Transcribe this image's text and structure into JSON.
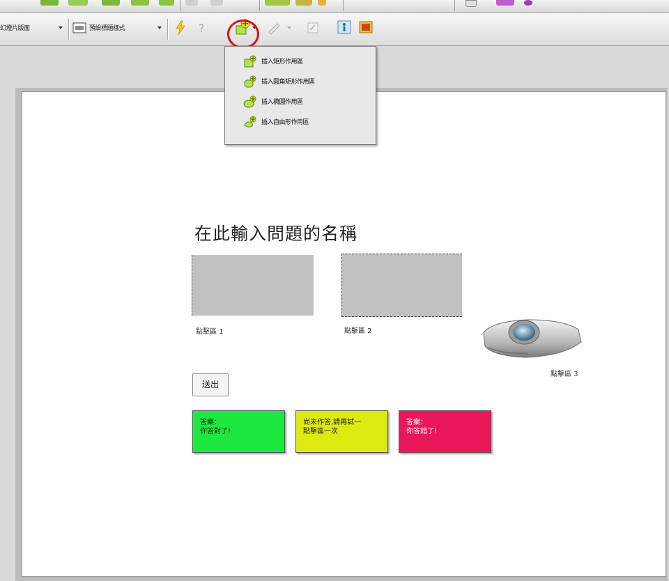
{
  "toolbar": {
    "slide_layout_label": "幻燈片版面",
    "text_style_label": "預設標題樣式",
    "insert_hotspot_tooltip_icon": "add-hotspot-icon"
  },
  "dropdown": {
    "items": [
      {
        "label": "插入矩形作用區"
      },
      {
        "label": "插入圓角矩形作用區"
      },
      {
        "label": "插入橢圓作用區"
      },
      {
        "label": "插入自由形作用區"
      }
    ]
  },
  "slide": {
    "title": "在此輸入問題的名稱",
    "hotspot1_caption": "點擊區 1",
    "hotspot2_caption": "點擊區 2",
    "hotspot3_caption": "點擊區 3",
    "exit_button_label": "送出",
    "feedback": {
      "correct_line1": "答案：",
      "correct_line2": "你答對了!",
      "incomplete_line1": "尚未作答,請再試一",
      "incomplete_line2": "點擊區一次",
      "incorrect_line1": "答案：",
      "incorrect_line2": "你答錯了!"
    }
  },
  "colors": {
    "correct": "#1ee83f",
    "incomplete": "#dcea0f",
    "incorrect": "#e9175a",
    "highlight": "#e01010"
  }
}
